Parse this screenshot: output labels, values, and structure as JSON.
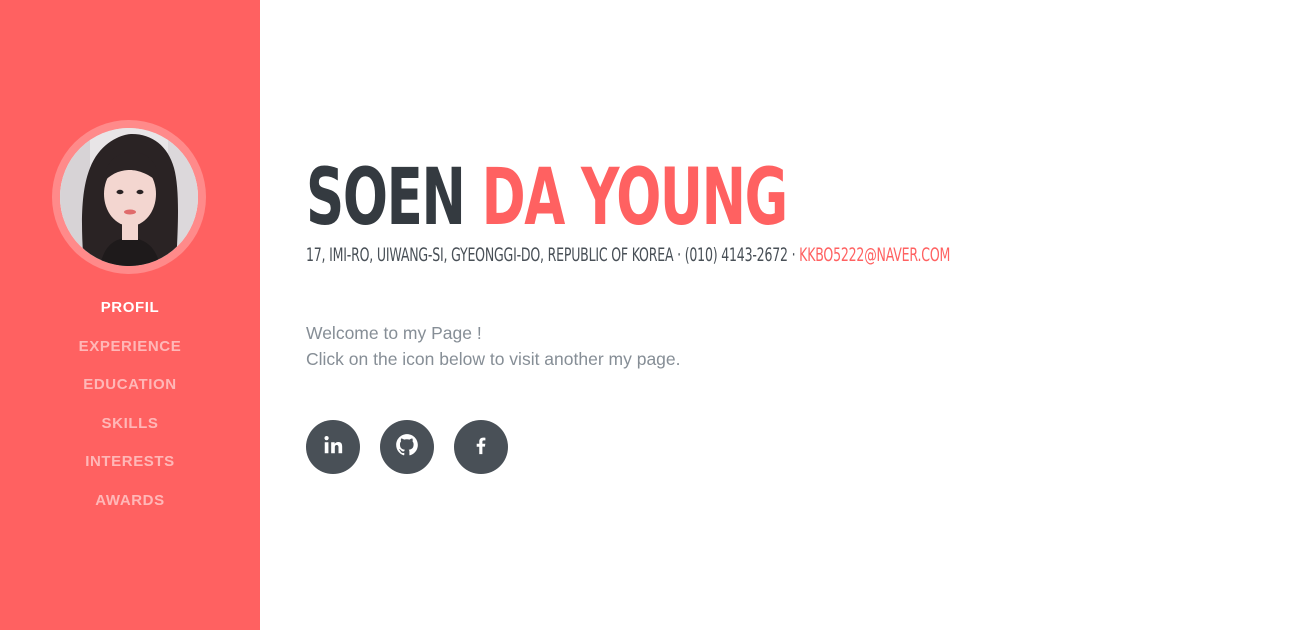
{
  "sidebar": {
    "nav": [
      {
        "label": "PROFIL",
        "active": true
      },
      {
        "label": "EXPERIENCE"
      },
      {
        "label": "EDUCATION"
      },
      {
        "label": "SKILLS"
      },
      {
        "label": "INTERESTS"
      },
      {
        "label": "AWARDS"
      }
    ]
  },
  "profile": {
    "first_name": "SOEN",
    "last_name": "DA YOUNG",
    "address": "17, IMI-RO, UIWANG-SI, GYEONGGI-DO, REPUBLIC OF KOREA",
    "separator": " · ",
    "phone": "(010) 4143-2672",
    "email": "KKBO5222@NAVER.COM",
    "welcome_line1": "Welcome to my Page !",
    "welcome_line2": "Click on the icon below to visit another my page."
  },
  "social": [
    {
      "icon": "linkedin-icon"
    },
    {
      "icon": "github-icon"
    },
    {
      "icon": "facebook-icon"
    }
  ],
  "colors": {
    "accent": "#ff6161",
    "dark": "#343a40",
    "icon_bg": "#495057",
    "muted_text": "#868e96"
  }
}
